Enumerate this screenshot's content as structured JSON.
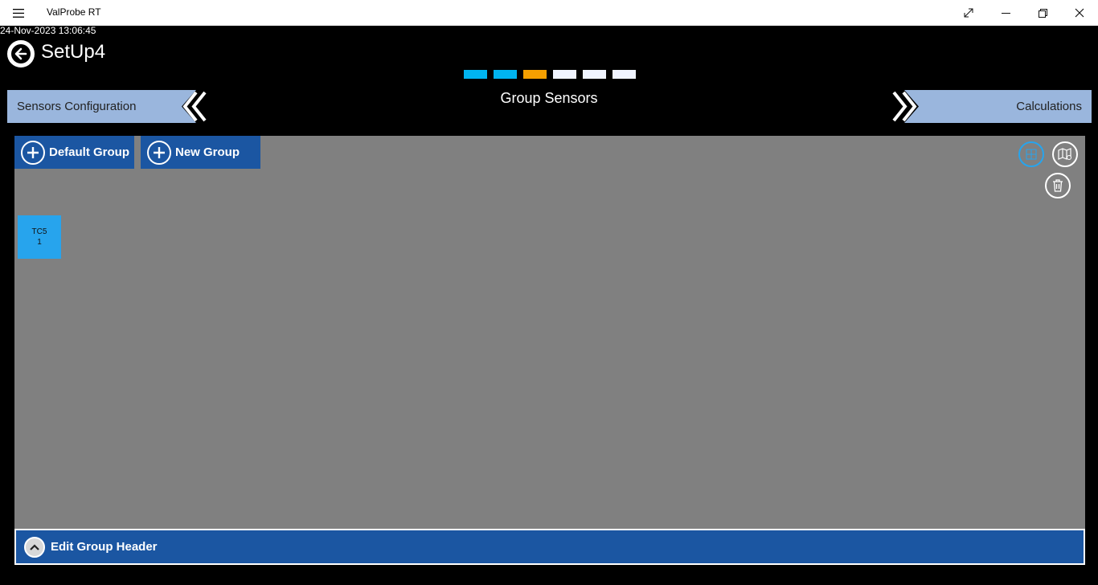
{
  "window": {
    "title": "ValProbe RT",
    "buttons": {
      "expand": "⤢",
      "minimize": "—",
      "restore": "❐",
      "close": "✕"
    }
  },
  "timestamp": "24-Nov-2023 13:06:45",
  "page": {
    "title": "SetUp4",
    "section_title": "Group Sensors"
  },
  "steps": [
    {
      "color": "#00b4f0"
    },
    {
      "color": "#00b4f0"
    },
    {
      "color": "#f5a000"
    },
    {
      "color": "#f0f4ff"
    },
    {
      "color": "#f0f4ff"
    },
    {
      "color": "#f0f4ff"
    }
  ],
  "nav": {
    "prev_label": "Sensors Configuration",
    "next_label": "Calculations"
  },
  "toolbar": {
    "default_group_label": "Default Group",
    "new_group_label": "New Group"
  },
  "sensors": [
    {
      "name": "TC5",
      "number": "1"
    }
  ],
  "footer": {
    "label": "Edit Group Header"
  },
  "colors": {
    "accent": "#1b56a2",
    "nav_bg": "#9ab6dd",
    "panel_bg": "#808080",
    "tile": "#27a4ed"
  }
}
